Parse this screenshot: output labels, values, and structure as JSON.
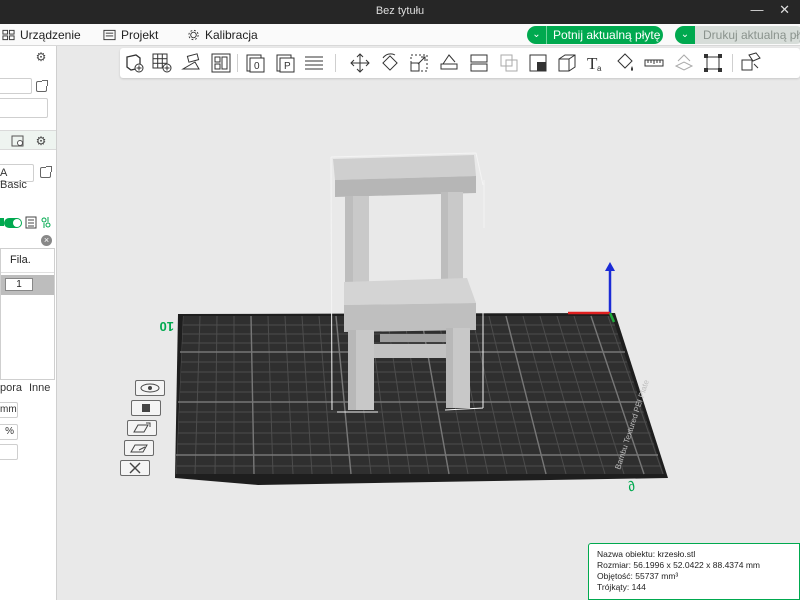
{
  "window": {
    "title": "Bez tytułu"
  },
  "menu": {
    "items": [
      {
        "label": "Urządzenie"
      },
      {
        "label": "Projekt"
      },
      {
        "label": "Kalibracja"
      }
    ],
    "slice_button": "Potnij aktualną płytę",
    "print_button": "Drukuj aktualną płytę"
  },
  "left_panel": {
    "filament_preset": "A Basic",
    "table_header": "Fila.",
    "table_row_value": "1",
    "tabs": [
      "pora",
      "Inne"
    ],
    "unit_mm": "mm",
    "unit_percent": "%"
  },
  "bed": {
    "front_label": "10",
    "side_label": "Bambu Textured PEI Plate",
    "corner_mark": "∂"
  },
  "object_info": {
    "name_label": "Nazwa obiektu: krzesło.stl",
    "size_label": "Rozmiar: 56.1996 x 52.0422 x 88.4374 mm",
    "volume_label": "Objętość: 55737 mm³",
    "triangles_label": "Trójkąty: 144"
  },
  "colors": {
    "accent": "#00a94f",
    "titlebar": "#262626",
    "viewport_bg": "#e9e9e9",
    "bed": "#2b2b2b"
  }
}
